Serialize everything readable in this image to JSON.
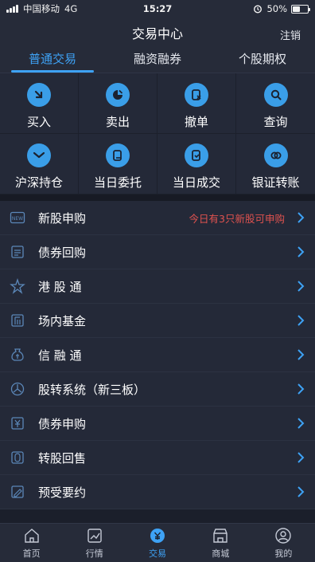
{
  "status": {
    "carrier": "中国移动",
    "network": "4G",
    "time": "15:27",
    "battery": "50%",
    "battery_level": 0.5
  },
  "header": {
    "title": "交易中心",
    "logout": "注销"
  },
  "tabs": [
    {
      "label": "普通交易",
      "active": true
    },
    {
      "label": "融资融券",
      "active": false
    },
    {
      "label": "个股期权",
      "active": false
    }
  ],
  "grid": [
    {
      "label": "买入",
      "icon": "buy-icon"
    },
    {
      "label": "卖出",
      "icon": "sell-icon"
    },
    {
      "label": "撤单",
      "icon": "cancel-order-icon"
    },
    {
      "label": "查询",
      "icon": "query-icon"
    },
    {
      "label": "沪深持仓",
      "icon": "holdings-icon"
    },
    {
      "label": "当日委托",
      "icon": "today-orders-icon"
    },
    {
      "label": "当日成交",
      "icon": "today-deals-icon"
    },
    {
      "label": "银证转账",
      "icon": "bank-transfer-icon"
    }
  ],
  "list": [
    {
      "label": "新股申购",
      "icon": "new-badge-icon",
      "note": "今日有3只新股可申购"
    },
    {
      "label": "债券回购",
      "icon": "bond-repo-icon"
    },
    {
      "label": "港 股 通",
      "icon": "hk-connect-icon"
    },
    {
      "label": "场内基金",
      "icon": "fund-icon"
    },
    {
      "label": "信 融 通",
      "icon": "credit-icon"
    },
    {
      "label": "股转系统（新三板）",
      "icon": "neeq-icon"
    },
    {
      "label": "债券申购",
      "icon": "bond-subscribe-icon"
    },
    {
      "label": "转股回售",
      "icon": "convert-icon"
    },
    {
      "label": "预受要约",
      "icon": "tender-offer-icon"
    }
  ],
  "nav": [
    {
      "label": "首页",
      "icon": "home-icon",
      "active": false
    },
    {
      "label": "行情",
      "icon": "market-icon",
      "active": false
    },
    {
      "label": "交易",
      "icon": "trade-icon",
      "active": true
    },
    {
      "label": "商城",
      "icon": "store-icon",
      "active": false
    },
    {
      "label": "我的",
      "icon": "profile-icon",
      "active": false
    }
  ],
  "colors": {
    "accent": "#3ea2f5",
    "alert": "#e0524f",
    "background": "#242938"
  }
}
